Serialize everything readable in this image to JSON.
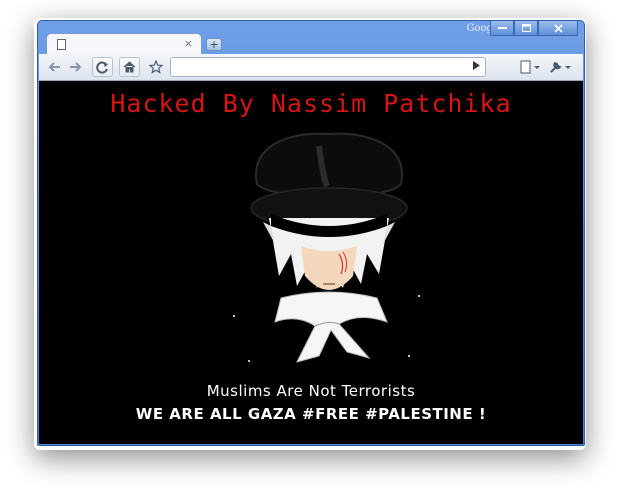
{
  "window": {
    "brand": "Google",
    "minimize_icon": "minimize-icon",
    "maximize_icon": "maximize-icon",
    "close_icon": "close-icon"
  },
  "tab": {
    "icon": "page-icon",
    "close_label": "×"
  },
  "new_tab_label": "+",
  "toolbar": {
    "back_icon": "back-arrow-icon",
    "forward_icon": "forward-arrow-icon",
    "reload_icon": "reload-icon",
    "home_icon": "home-icon",
    "star_icon": "star-icon",
    "address_value": "",
    "go_icon": "play-icon",
    "page_menu_icon": "page-menu-icon",
    "wrench_icon": "wrench-icon"
  },
  "page": {
    "title": "Hacked By Nassim Patchika",
    "line1": "Muslims Are Not Terrorists",
    "line2": "WE ARE ALL GAZA #FREE #PALESTINE !"
  },
  "colors": {
    "title": "#d61515",
    "background": "#000000",
    "text": "#ffffff",
    "frame": "#4f86d9"
  }
}
